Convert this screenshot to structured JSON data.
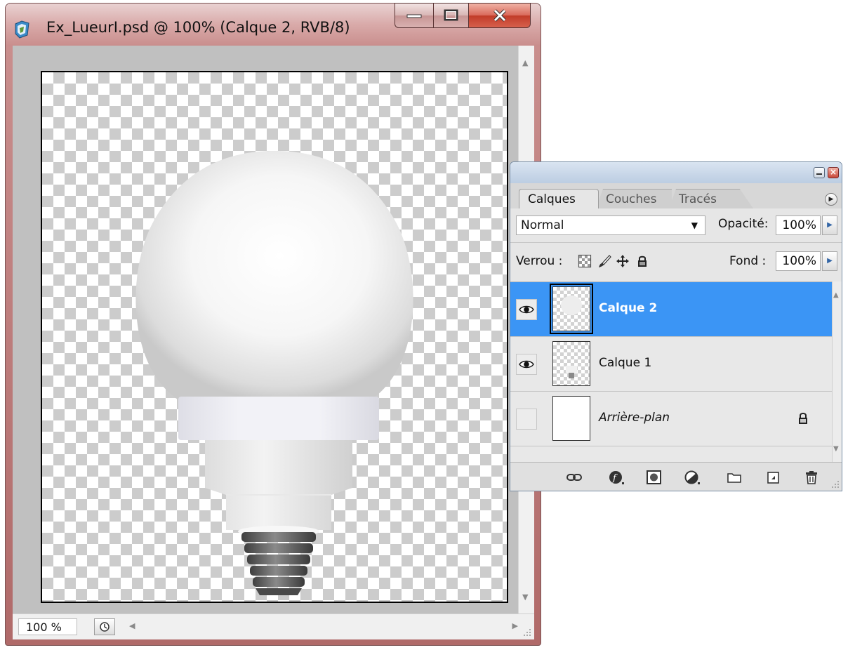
{
  "document": {
    "title": "Ex_LueurI.psd @ 100% (Calque 2, RVB/8)",
    "zoom": "100 %"
  },
  "layers_panel": {
    "tabs": [
      "Calques",
      "Couches",
      "Tracés"
    ],
    "active_tab": "Calques",
    "blend_mode": "Normal",
    "opacity_label": "Opacité:",
    "opacity_value": "100%",
    "lock_label": "Verrou :",
    "fill_label": "Fond :",
    "fill_value": "100%",
    "layers": [
      {
        "name": "Calque 2",
        "visible": true,
        "selected": true,
        "locked": false
      },
      {
        "name": "Calque 1",
        "visible": true,
        "selected": false,
        "locked": false
      },
      {
        "name": "Arrière-plan",
        "visible": false,
        "selected": false,
        "locked": true
      }
    ],
    "footer_icons": [
      "link-layers-icon",
      "layer-style-icon",
      "layer-mask-icon",
      "adjustment-layer-icon",
      "new-group-icon",
      "new-layer-icon",
      "delete-layer-icon"
    ]
  },
  "colors": {
    "title_bar": "#d9aaa9",
    "selection": "#3b95f5",
    "canvas_bg": "#c0c0c0"
  }
}
